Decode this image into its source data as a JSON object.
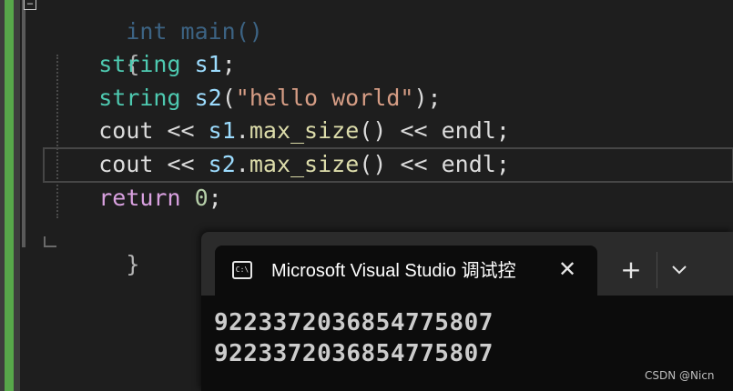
{
  "editor": {
    "lines": [
      {
        "faint_text": "int main()"
      },
      {
        "text": "{"
      },
      {
        "type": "string",
        "var": "s1",
        "tail": ";"
      },
      {
        "type": "string",
        "var": "s2",
        "paren_open": "(",
        "str": "\"hello world\"",
        "tail": ");"
      },
      {
        "cout": "cout",
        "op": "<<",
        "obj": "s1",
        "dot": ".",
        "fn": "max_size",
        "call": "()",
        "op2": "<<",
        "endl": "endl",
        "tail": ";"
      },
      {
        "cout": "cout",
        "op": "<<",
        "obj": "s2",
        "dot": ".",
        "fn": "max_size",
        "call": "()",
        "op2": "<<",
        "endl": "endl",
        "tail": ";"
      },
      {
        "kw": "return",
        "num": "0",
        "tail": ";"
      },
      {
        "text": "}"
      }
    ],
    "fold_glyph": "−"
  },
  "console": {
    "tab_icon_label": "C:\\",
    "tab_title": "Microsoft Visual Studio 调试控",
    "close_glyph": "✕",
    "new_tab_glyph": "+",
    "dropdown_icon": "chevron-down-icon",
    "output": [
      "9223372036854775807",
      "9223372036854775807"
    ]
  },
  "watermark": "CSDN @Nicn",
  "colors": {
    "editor_bg": "#1e1e1e",
    "console_bg": "#0c0c0c",
    "tabbar_bg": "#2b2b2b",
    "change_bar": "#57a64a"
  }
}
